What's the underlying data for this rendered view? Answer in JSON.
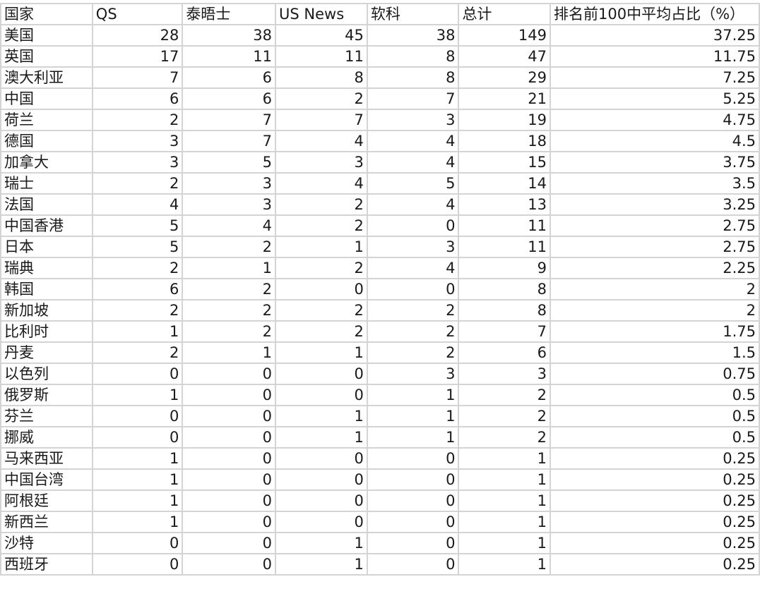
{
  "sheet": {
    "headers": [
      "国家",
      "QS",
      "泰晤士",
      "US News",
      "软科",
      "总计",
      "排名前100中平均占比（%）"
    ],
    "rows": [
      [
        "美国",
        "28",
        "38",
        "45",
        "38",
        "149",
        "37.25"
      ],
      [
        "英国",
        "17",
        "11",
        "11",
        "8",
        "47",
        "11.75"
      ],
      [
        "澳大利亚",
        "7",
        "6",
        "8",
        "8",
        "29",
        "7.25"
      ],
      [
        "中国",
        "6",
        "6",
        "2",
        "7",
        "21",
        "5.25"
      ],
      [
        "荷兰",
        "2",
        "7",
        "7",
        "3",
        "19",
        "4.75"
      ],
      [
        "德国",
        "3",
        "7",
        "4",
        "4",
        "18",
        "4.5"
      ],
      [
        "加拿大",
        "3",
        "5",
        "3",
        "4",
        "15",
        "3.75"
      ],
      [
        "瑞士",
        "2",
        "3",
        "4",
        "5",
        "14",
        "3.5"
      ],
      [
        "法国",
        "4",
        "3",
        "2",
        "4",
        "13",
        "3.25"
      ],
      [
        "中国香港",
        "5",
        "4",
        "2",
        "0",
        "11",
        "2.75"
      ],
      [
        "日本",
        "5",
        "2",
        "1",
        "3",
        "11",
        "2.75"
      ],
      [
        "瑞典",
        "2",
        "1",
        "2",
        "4",
        "9",
        "2.25"
      ],
      [
        "韩国",
        "6",
        "2",
        "0",
        "0",
        "8",
        "2"
      ],
      [
        "新加坡",
        "2",
        "2",
        "2",
        "2",
        "8",
        "2"
      ],
      [
        "比利时",
        "1",
        "2",
        "2",
        "2",
        "7",
        "1.75"
      ],
      [
        "丹麦",
        "2",
        "1",
        "1",
        "2",
        "6",
        "1.5"
      ],
      [
        "以色列",
        "0",
        "0",
        "0",
        "3",
        "3",
        "0.75"
      ],
      [
        "俄罗斯",
        "1",
        "0",
        "0",
        "1",
        "2",
        "0.5"
      ],
      [
        "芬兰",
        "0",
        "0",
        "1",
        "1",
        "2",
        "0.5"
      ],
      [
        "挪威",
        "0",
        "0",
        "1",
        "1",
        "2",
        "0.5"
      ],
      [
        "马来西亚",
        "1",
        "0",
        "0",
        "0",
        "1",
        "0.25"
      ],
      [
        "中国台湾",
        "1",
        "0",
        "0",
        "0",
        "1",
        "0.25"
      ],
      [
        "阿根廷",
        "1",
        "0",
        "0",
        "0",
        "1",
        "0.25"
      ],
      [
        "新西兰",
        "1",
        "0",
        "0",
        "0",
        "1",
        "0.25"
      ],
      [
        "沙特",
        "0",
        "0",
        "1",
        "0",
        "1",
        "0.25"
      ],
      [
        "西班牙",
        "0",
        "0",
        "1",
        "0",
        "1",
        "0.25"
      ]
    ]
  }
}
